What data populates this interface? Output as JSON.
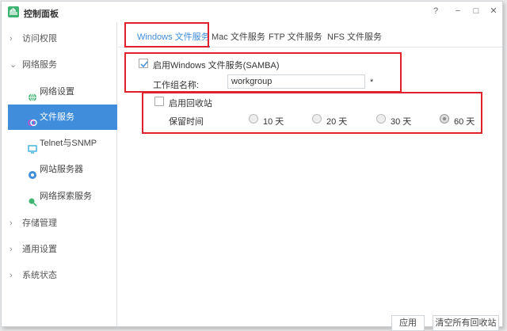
{
  "window": {
    "title": "控制面板",
    "help": "?",
    "minimize": "−",
    "maximize": "□",
    "close": "✕"
  },
  "sidebar": {
    "groups": [
      {
        "label": "访问权限",
        "expanded": false
      },
      {
        "label": "网络服务",
        "expanded": true
      },
      {
        "label": "存储管理",
        "expanded": false
      },
      {
        "label": "通用设置",
        "expanded": false
      },
      {
        "label": "系统状态",
        "expanded": false
      }
    ],
    "sub_items": [
      {
        "label": "网络设置",
        "icon": "globe-icon"
      },
      {
        "label": "文件服务",
        "icon": "file-service-icon",
        "active": true
      },
      {
        "label": "Telnet与SNMP",
        "icon": "monitor-icon"
      },
      {
        "label": "网站服务器",
        "icon": "web-server-icon"
      },
      {
        "label": "网络探索服务",
        "icon": "network-discovery-icon"
      }
    ],
    "chevron_collapsed": "›",
    "chevron_expanded": "⌄"
  },
  "tabs": [
    {
      "label": "Windows 文件服务",
      "active": true
    },
    {
      "label": "Mac 文件服务"
    },
    {
      "label": "FTP 文件服务"
    },
    {
      "label": "NFS 文件服务"
    }
  ],
  "samba": {
    "enable_label": "启用Windows 文件服务(SAMBA)",
    "enabled": true,
    "workgroup_label": "工作组名称:",
    "workgroup_value": "workgroup",
    "required_mark": "*"
  },
  "recycle": {
    "enable_label": "启用回收站",
    "enabled": false,
    "retention_label": "保留时间",
    "options": [
      "10 天",
      "20 天",
      "30 天",
      "60 天"
    ],
    "selected_index": 3
  },
  "footer": {
    "apply_label": "应用",
    "clear_label": "清空所有回收站"
  },
  "colors": {
    "accent": "#3f8ddb",
    "highlight_box": "#e0222e"
  }
}
